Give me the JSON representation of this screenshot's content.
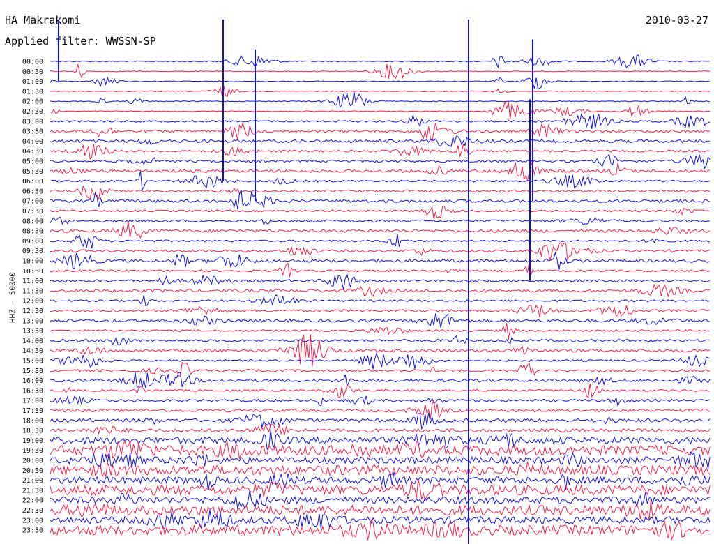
{
  "header": {
    "station": "HA Makrakomi",
    "filter": "Applied filter: WWSSN-SP",
    "date": "2010-03-27"
  },
  "chart_data": {
    "type": "line",
    "title": "HA Makrakomi",
    "ylabel": "HHZ - 50000",
    "rows": [
      "00:00",
      "00:30",
      "01:00",
      "01:30",
      "02:00",
      "02:30",
      "03:00",
      "03:30",
      "04:00",
      "04:30",
      "05:00",
      "05:30",
      "06:00",
      "06:30",
      "07:00",
      "07:30",
      "08:00",
      "08:30",
      "09:00",
      "09:30",
      "10:00",
      "10:30",
      "11:00",
      "11:30",
      "12:00",
      "12:30",
      "13:00",
      "13:30",
      "14:00",
      "14:30",
      "15:00",
      "15:30",
      "16:00",
      "16:30",
      "17:00",
      "17:30",
      "18:00",
      "18:30",
      "19:00",
      "19:30",
      "20:00",
      "20:30",
      "21:00",
      "21:30",
      "22:00",
      "22:30",
      "23:00",
      "23:30"
    ],
    "colors": [
      "#1010e0",
      "#f0204a"
    ],
    "grid": false
  }
}
